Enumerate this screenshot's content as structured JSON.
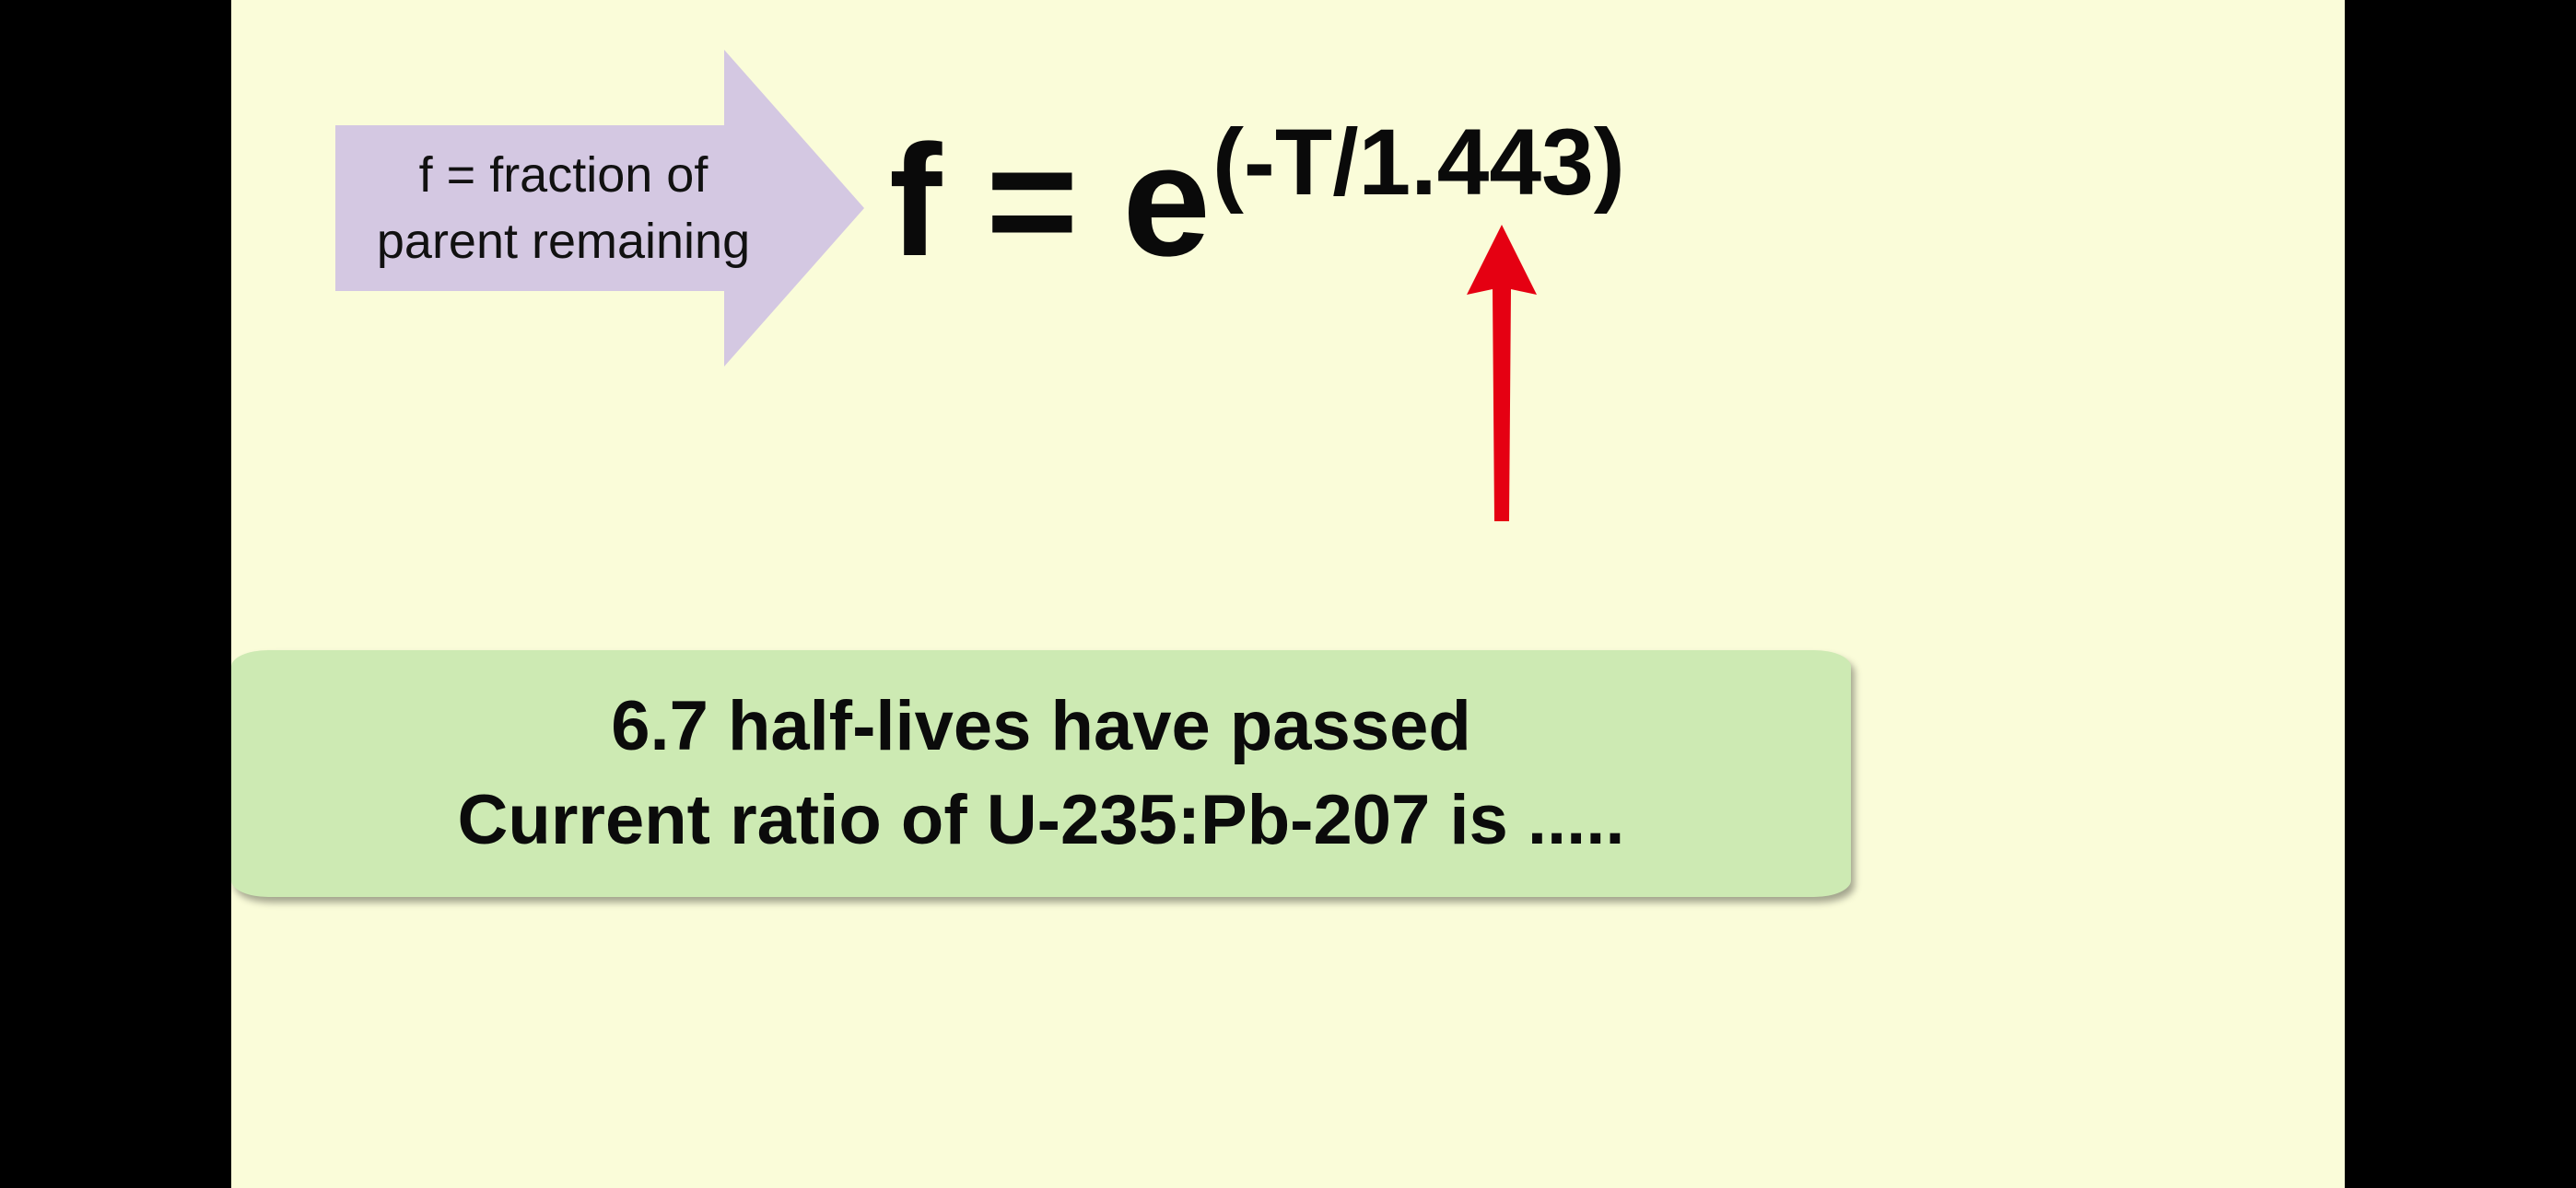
{
  "callout": {
    "line1": "f = fraction of",
    "line2": "parent remaining",
    "color": "#d4c8e2"
  },
  "formula": {
    "main": "f = e",
    "exponent": "(-T/1.443)"
  },
  "pointer": {
    "color": "#e50012",
    "icon": "red-up-arrow"
  },
  "banner": {
    "line1": "6.7 half-lives have passed",
    "line2": "Current ratio of U-235:Pb-207 is .....",
    "color": "#cdeab3"
  },
  "colors": {
    "background": "#fafcd9",
    "letterbox": "#000000"
  }
}
